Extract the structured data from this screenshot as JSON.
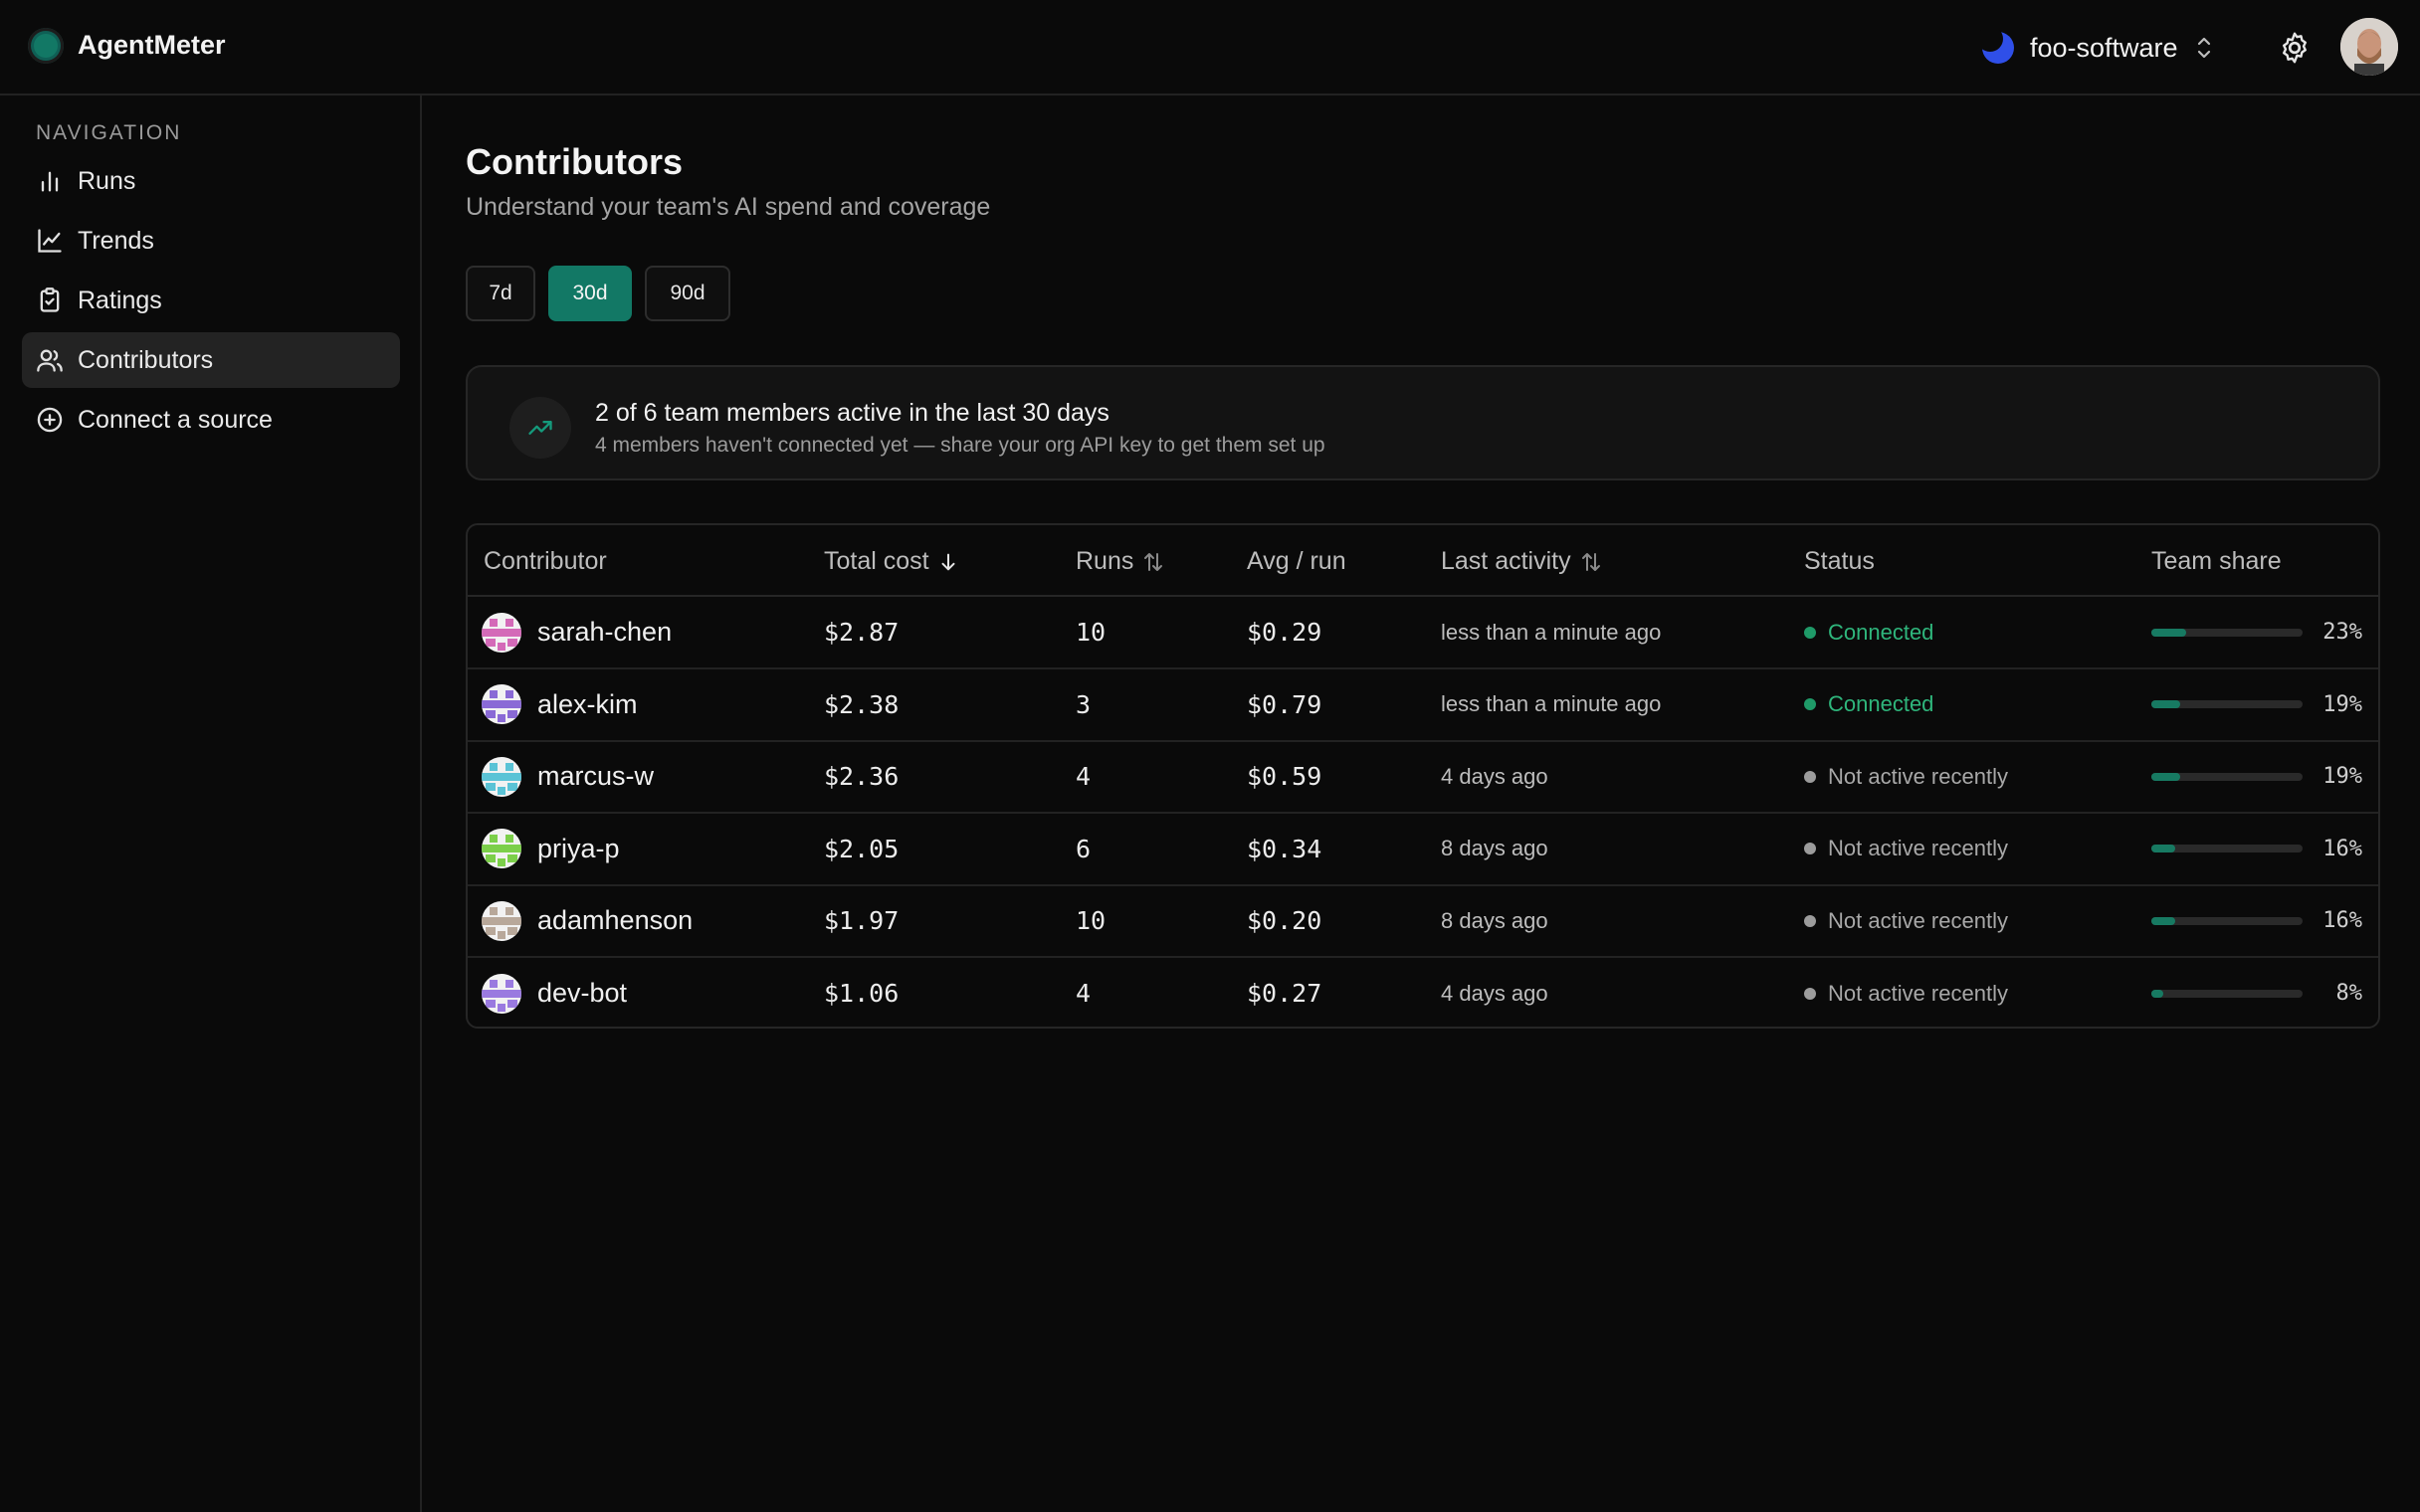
{
  "app": {
    "name": "AgentMeter"
  },
  "org": {
    "name": "foo-software"
  },
  "nav": {
    "heading": "NAVIGATION",
    "items": [
      {
        "label": "Runs",
        "icon": "bar-chart-icon"
      },
      {
        "label": "Trends",
        "icon": "line-chart-icon"
      },
      {
        "label": "Ratings",
        "icon": "clipboard-check-icon"
      },
      {
        "label": "Contributors",
        "icon": "users-icon",
        "active": true
      },
      {
        "label": "Connect a source",
        "icon": "plus-circle-icon"
      }
    ]
  },
  "page": {
    "title": "Contributors",
    "subtitle": "Understand your team's AI spend and coverage",
    "ranges": [
      "7d",
      "30d",
      "90d"
    ],
    "active_range": "30d"
  },
  "banner": {
    "title": "2 of 6 team members active in the last 30 days",
    "subtitle": "4 members haven't connected yet — share your org API key to get them set up"
  },
  "table": {
    "columns": {
      "contributor": "Contributor",
      "total_cost": "Total cost",
      "runs": "Runs",
      "avg_run": "Avg / run",
      "last_activity": "Last activity",
      "status": "Status",
      "team_share": "Team share"
    },
    "rows": [
      {
        "name": "sarah-chen",
        "cost": "$2.87",
        "runs": "10",
        "avg": "$0.29",
        "last": "less than a minute ago",
        "status": "Connected",
        "connected": true,
        "share": "23%",
        "share_value": 0.23,
        "avatar_color": "#d46ab8"
      },
      {
        "name": "alex-kim",
        "cost": "$2.38",
        "runs": "3",
        "avg": "$0.79",
        "last": "less than a minute ago",
        "status": "Connected",
        "connected": true,
        "share": "19%",
        "share_value": 0.19,
        "avatar_color": "#8a6ad6"
      },
      {
        "name": "marcus-w",
        "cost": "$2.36",
        "runs": "4",
        "avg": "$0.59",
        "last": "4 days ago",
        "status": "Not active recently",
        "connected": false,
        "share": "19%",
        "share_value": 0.19,
        "avatar_color": "#5ac3d6"
      },
      {
        "name": "priya-p",
        "cost": "$2.05",
        "runs": "6",
        "avg": "$0.34",
        "last": "8 days ago",
        "status": "Not active recently",
        "connected": false,
        "share": "16%",
        "share_value": 0.16,
        "avatar_color": "#7ccf4a"
      },
      {
        "name": "adamhenson",
        "cost": "$1.97",
        "runs": "10",
        "avg": "$0.20",
        "last": "8 days ago",
        "status": "Not active recently",
        "connected": false,
        "share": "16%",
        "share_value": 0.16,
        "avatar_color": "#b8a89a"
      },
      {
        "name": "dev-bot",
        "cost": "$1.06",
        "runs": "4",
        "avg": "$0.27",
        "last": "4 days ago",
        "status": "Not active recently",
        "connected": false,
        "share": "8%",
        "share_value": 0.08,
        "avatar_color": "#9a7ae0"
      }
    ]
  },
  "colors": {
    "accent": "#127865",
    "connected": "#2fb67c",
    "inactive": "#a8a8a8",
    "background": "#0a0a0a"
  }
}
